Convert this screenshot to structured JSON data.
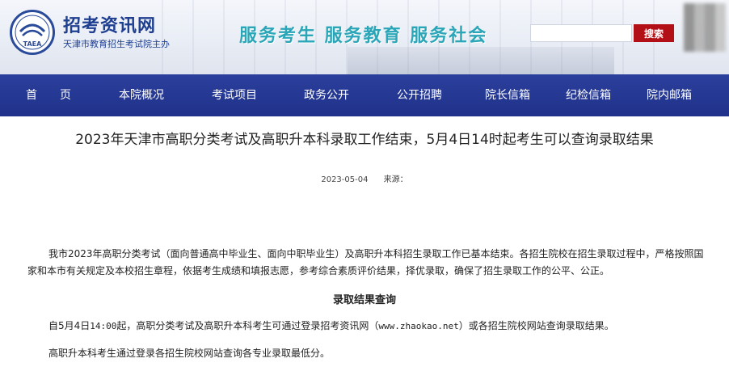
{
  "header": {
    "site_title": "招考资讯网",
    "site_subtitle": "天津市教育招生考试院主办",
    "logo_text": "TAEA",
    "slogan": "服务考生  服务教育  服务社会",
    "search_placeholder": "",
    "search_button": "搜索"
  },
  "nav": {
    "items": [
      "首　　页",
      "本院概况",
      "考试项目",
      "政务公开",
      "公开招聘",
      "院长信箱",
      "纪检信箱",
      "院内邮箱"
    ]
  },
  "article": {
    "title": "2023年天津市高职分类考试及高职升本科录取工作结束，5月4日14时起考生可以查询录取结果",
    "date": "2023-05-04",
    "source_label": "来源：",
    "paragraph1": "我市2023年高职分类考试（面向普通高中毕业生、面向中职毕业生）及高职升本科招生录取工作已基本结束。各招生院校在招生录取过程中，严格按照国家和本市有关规定及本校招生章程，依据考生成绩和填报志愿，参考综合素质评价结果，择优录取，确保了招生录取工作的公平、公正。",
    "section_heading": "录取结果查询",
    "paragraph2_a": "自5月4日",
    "paragraph2_time": "14:00",
    "paragraph2_b": "起，高职分类考试及高职升本科考生可通过登录招考资讯网（",
    "paragraph2_url": "www.zhaokao.net",
    "paragraph2_c": "）或各招生院校网站查询录取结果。",
    "paragraph3": "高职升本科考生通过登录各招生院校网站查询各专业录取最低分。"
  },
  "colors": {
    "nav_bg": "#1f318a",
    "title_blue": "#1f3f91",
    "slogan_teal": "#2aa6b8",
    "search_red": "#b30f16"
  }
}
